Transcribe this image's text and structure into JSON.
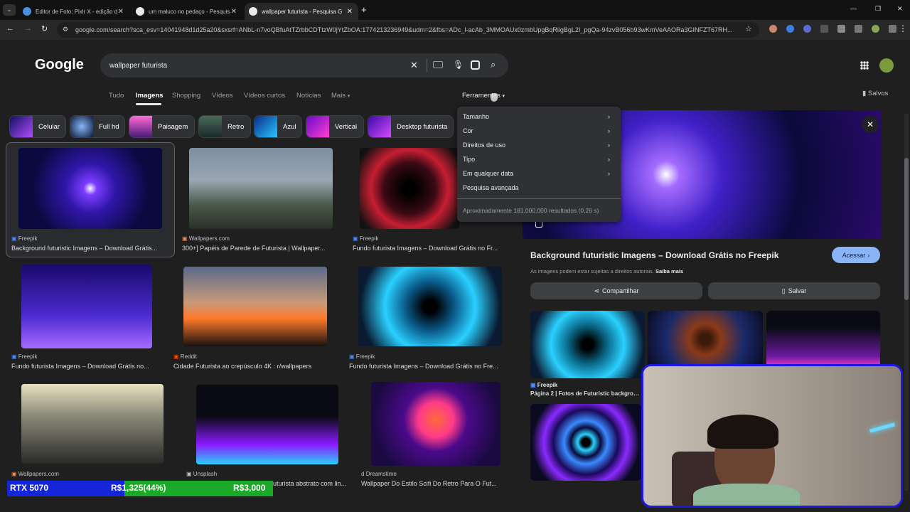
{
  "tabs": [
    {
      "label": "Editor de Foto: Pixlr X - edição d",
      "close": "✕"
    },
    {
      "label": "um maluco no pedaço - Pesquis",
      "close": "✕"
    },
    {
      "label": "wallpaper futurista - Pesquisa G",
      "close": "✕"
    }
  ],
  "new_tab": "+",
  "window_controls": {
    "minimize": "—",
    "restore": "❐",
    "close": "✕"
  },
  "url": "google.com/search?sca_esv=14041948d1d25a20&sxsrf=ANbL-n7voQBfuAtTZrbbCDTtzW0jYtZbOA:1774213236949&udm=2&fbs=ADc_l-acAb_3MMOAUx0zmbUpgBqRiigBgL2I_pgQa-94zvB056b93wKmVeAAORa3GINFZT67RH...",
  "google_logo": "Google",
  "search": {
    "query": "wallpaper futurista"
  },
  "nav": {
    "all": "Tudo",
    "images": "Imagens",
    "shopping": "Shopping",
    "videos": "Vídeos",
    "short_videos": "Vídeos curtos",
    "news": "Notícias",
    "more": "Mais",
    "tools": "Ferramentas",
    "saved": "Salvos"
  },
  "chips": [
    "Celular",
    "Full hd",
    "Paisagem",
    "Retro",
    "Azul",
    "Vertical",
    "Desktop futurista"
  ],
  "tools_menu": {
    "items": [
      "Tamanho",
      "Cor",
      "Direitos de uso",
      "Tipo",
      "Em qualquer data",
      "Pesquisa avançada"
    ],
    "results": "Aproximadamente 181.000.000 resultados (0,26 s)"
  },
  "results": [
    {
      "source": "Freepik",
      "title": "Background futuristic Imagens – Download Grátis..."
    },
    {
      "source": "Wallpapers.com",
      "title": "300+] Papéis de Parede de Futurista | Wallpaper..."
    },
    {
      "source": "Freepik",
      "title": "Fundo futurista Imagens – Download Grátis no Fr..."
    },
    {
      "source": "Freepik",
      "title": "Fundo futurista Imagens – Download Grátis no..."
    },
    {
      "source": "Reddit",
      "title": "Cidade Futurista ao crepúsculo 4K : r/wallpapers"
    },
    {
      "source": "Freepik",
      "title": "Fundo futurista Imagens – Download Grátis no Fre..."
    },
    {
      "source": "Wallpapers.com",
      "title": ""
    },
    {
      "source": "Unsplash",
      "title": "uturista abstrato com lin..."
    },
    {
      "source": "Dreamstime",
      "title": "Wallpaper Do Estilo Scifi Do Retro Para O Fut..."
    }
  ],
  "preview": {
    "title": "Background futuristic Imagens – Download Grátis no Freepik",
    "access": "Acessar",
    "copyright": "As imagens podem estar sujeitas a direitos autorais.",
    "learn_more": "Saiba mais",
    "share": "Compartilhar",
    "save": "Salvar",
    "related_source": "Freepik",
    "related_title": "Página 2 | Fotos de Futuristic backgroun..."
  },
  "ticker": {
    "product": "RTX 5070",
    "price": "R$1,325(44%)",
    "target": "R$3,000",
    "progress_percent": 44
  }
}
